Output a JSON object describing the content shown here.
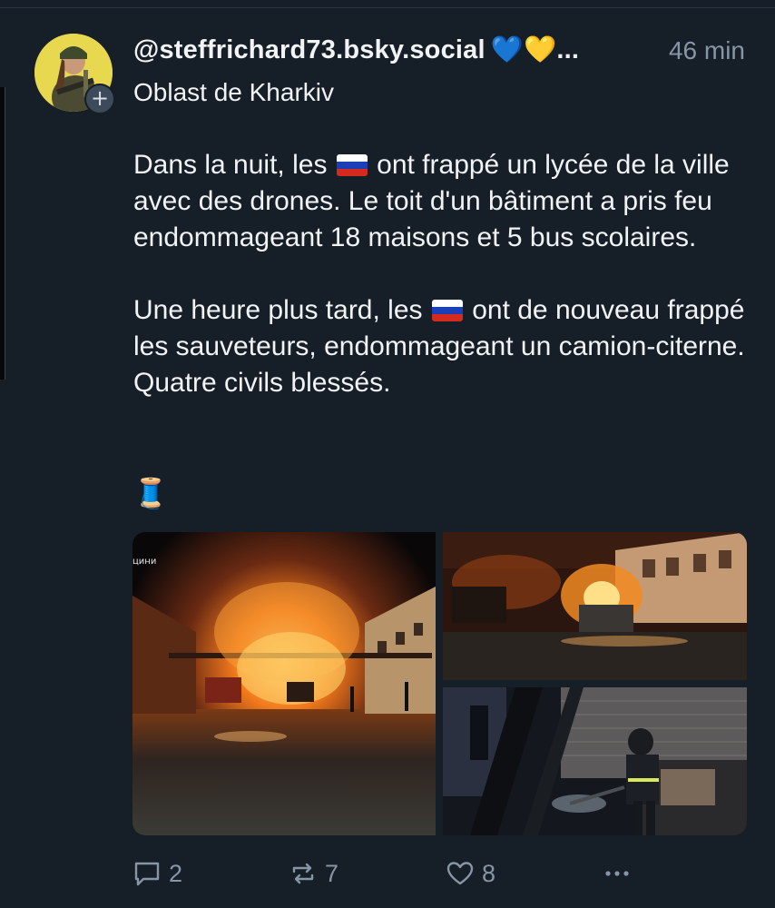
{
  "post": {
    "handle": "@steffrichard73.bsky.social",
    "handle_suffix": "💙💛...",
    "timestamp": "46 min",
    "display_line": "Oblast de Kharkiv",
    "paragraph_1_a": "Dans la nuit, les",
    "paragraph_1_b": "ont frappé un lycée de la ville avec des drones. Le toit d'un bâtiment a pris feu endommageant 18 maisons et 5 bus scolaires.",
    "paragraph_2_a": "Une heure plus tard, les",
    "paragraph_2_b": "ont de nouveau frappé les sauveteurs, endommageant un camion-citerne. Quatre civils blessés.",
    "thread_emoji": "🧵",
    "image_1_overlay_text": "цини"
  },
  "actions": {
    "reply_count": "2",
    "repost_count": "7",
    "like_count": "8"
  },
  "icons": {
    "reply": "speech-bubble-icon",
    "repost": "repost-arrows-icon",
    "like": "heart-icon",
    "more": "ellipsis-icon",
    "follow": "plus-icon"
  },
  "colors": {
    "background": "#161e27",
    "muted_text": "#8796a6",
    "text": "#f1f3f5"
  }
}
